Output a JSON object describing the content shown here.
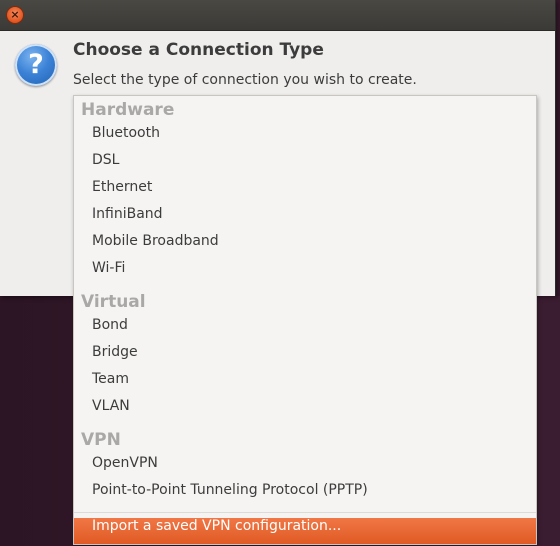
{
  "window": {
    "close_symbol": "×",
    "icon": "question-icon",
    "title": "Choose a Connection Type",
    "subtitle": "Select the type of connection you wish to create."
  },
  "menu": {
    "sections": [
      {
        "heading": "Hardware",
        "items": [
          "Bluetooth",
          "DSL",
          "Ethernet",
          "InfiniBand",
          "Mobile Broadband",
          "Wi-Fi"
        ]
      },
      {
        "heading": "Virtual",
        "items": [
          "Bond",
          "Bridge",
          "Team",
          "VLAN"
        ]
      },
      {
        "heading": "VPN",
        "items": [
          "OpenVPN",
          "Point-to-Point Tunneling Protocol (PPTP)"
        ]
      }
    ],
    "footer_item": "Import a saved VPN configuration...",
    "highlight_color": "#e9652f"
  }
}
